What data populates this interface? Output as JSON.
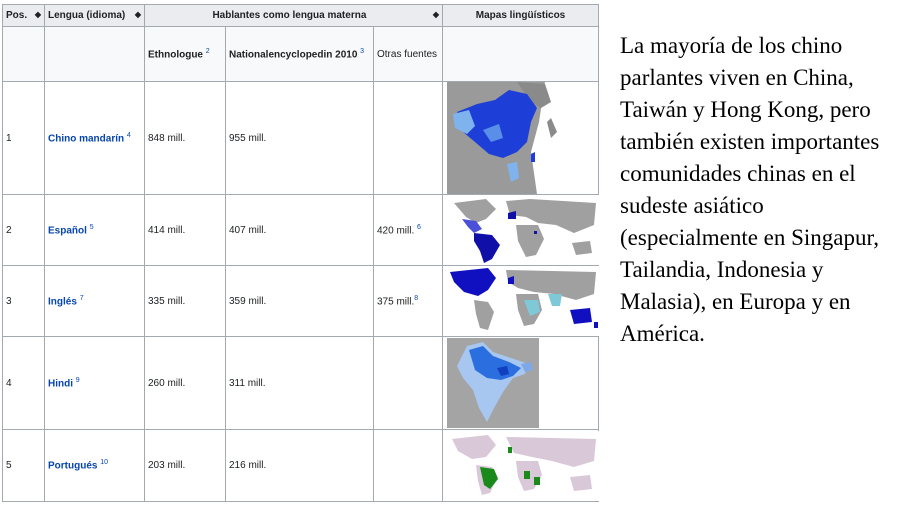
{
  "table": {
    "headers": {
      "pos": "Pos.",
      "lang": "Lengua (idioma)",
      "speakers": "Hablantes como lengua materna",
      "maps": "Mapas lingüísticos",
      "sort_icon": "◆"
    },
    "subheaders": {
      "ethnologue": "Ethnologue",
      "ethnologue_ref": "2",
      "ne": "Nationalencyclopedin 2010",
      "ne_ref": "3",
      "other": "Otras fuentes"
    },
    "rows": [
      {
        "pos": "1",
        "lang": "Chino mandarín",
        "ref": "4",
        "ethno": "848 mill.",
        "ne": "955 mill.",
        "other": "",
        "other_ref": "",
        "map": "china-map"
      },
      {
        "pos": "2",
        "lang": "Español",
        "ref": "5",
        "ethno": "414 mill.",
        "ne": "407 mill.",
        "other": "420 mill.",
        "other_ref": "6",
        "map": "spanish-world-map"
      },
      {
        "pos": "3",
        "lang": "Inglés",
        "ref": "7",
        "ethno": "335 mill.",
        "ne": "359 mill.",
        "other": "375 mill.",
        "other_ref": "8",
        "map": "english-world-map"
      },
      {
        "pos": "4",
        "lang": "Hindi",
        "ref": "9",
        "ethno": "260 mill.",
        "ne": "311 mill.",
        "other": "",
        "other_ref": "",
        "map": "india-map"
      },
      {
        "pos": "5",
        "lang": "Portugués",
        "ref": "10",
        "ethno": "203 mill.",
        "ne": "216 mill.",
        "other": "",
        "other_ref": "",
        "map": "portuguese-world-map"
      }
    ]
  },
  "side_text": "La mayoría de los chino parlantes viven  en China, Taiwán y Hong Kong, pero también existen importantes comunidades chinas en el sudeste asiático (especialmente en Singapur, Tailandia, Indonesia y Malasia), en Europa y en América.",
  "colors": {
    "header_bg": "#eaecf0",
    "link": "#0645ad",
    "border": "#a2a9b1",
    "map_dark_blue": "#1010d0",
    "map_light_blue": "#7fb3ee",
    "map_green": "#1a8a1a"
  }
}
